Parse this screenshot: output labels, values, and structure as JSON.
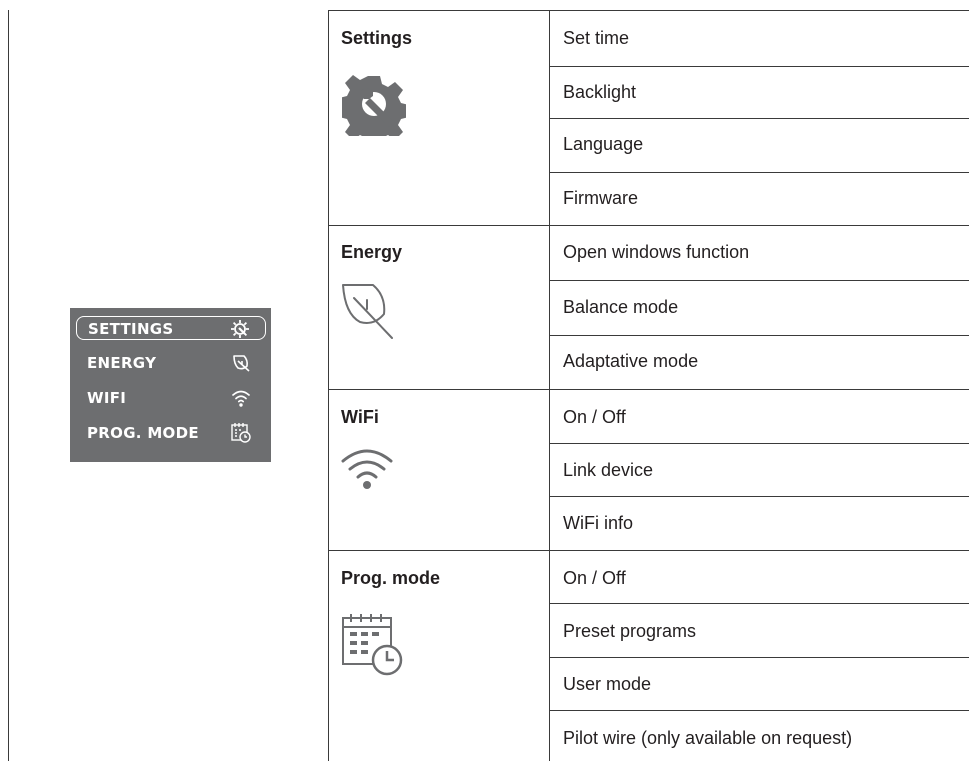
{
  "display": {
    "items": [
      {
        "label": "SETTINGS",
        "icon": "gear-wrench-icon",
        "selected": true
      },
      {
        "label": "ENERGY",
        "icon": "leaf-icon",
        "selected": false
      },
      {
        "label": "WIFI",
        "icon": "wifi-icon",
        "selected": false
      },
      {
        "label": "PROG. MODE",
        "icon": "calendar-clock-icon",
        "selected": false
      }
    ]
  },
  "menu": [
    {
      "title": "Settings",
      "icon": "gear-wrench-icon",
      "options": [
        "Set time",
        "Backlight",
        "Language",
        "Firmware"
      ]
    },
    {
      "title": "Energy",
      "icon": "leaf-icon",
      "options": [
        "Open windows function",
        "Balance mode",
        "Adaptative mode"
      ]
    },
    {
      "title": "WiFi",
      "icon": "wifi-icon",
      "options": [
        "On / Off",
        "Link device",
        "WiFi info"
      ]
    },
    {
      "title": "Prog. mode",
      "icon": "calendar-clock-icon",
      "options": [
        "On / Off",
        "Preset programs",
        "User mode",
        "Pilot wire (only available on request)"
      ]
    }
  ],
  "colors": {
    "panel": "#6d6e70",
    "lines": "#3a3a3a",
    "text": "#231f20",
    "icon": "#6d6e70"
  }
}
